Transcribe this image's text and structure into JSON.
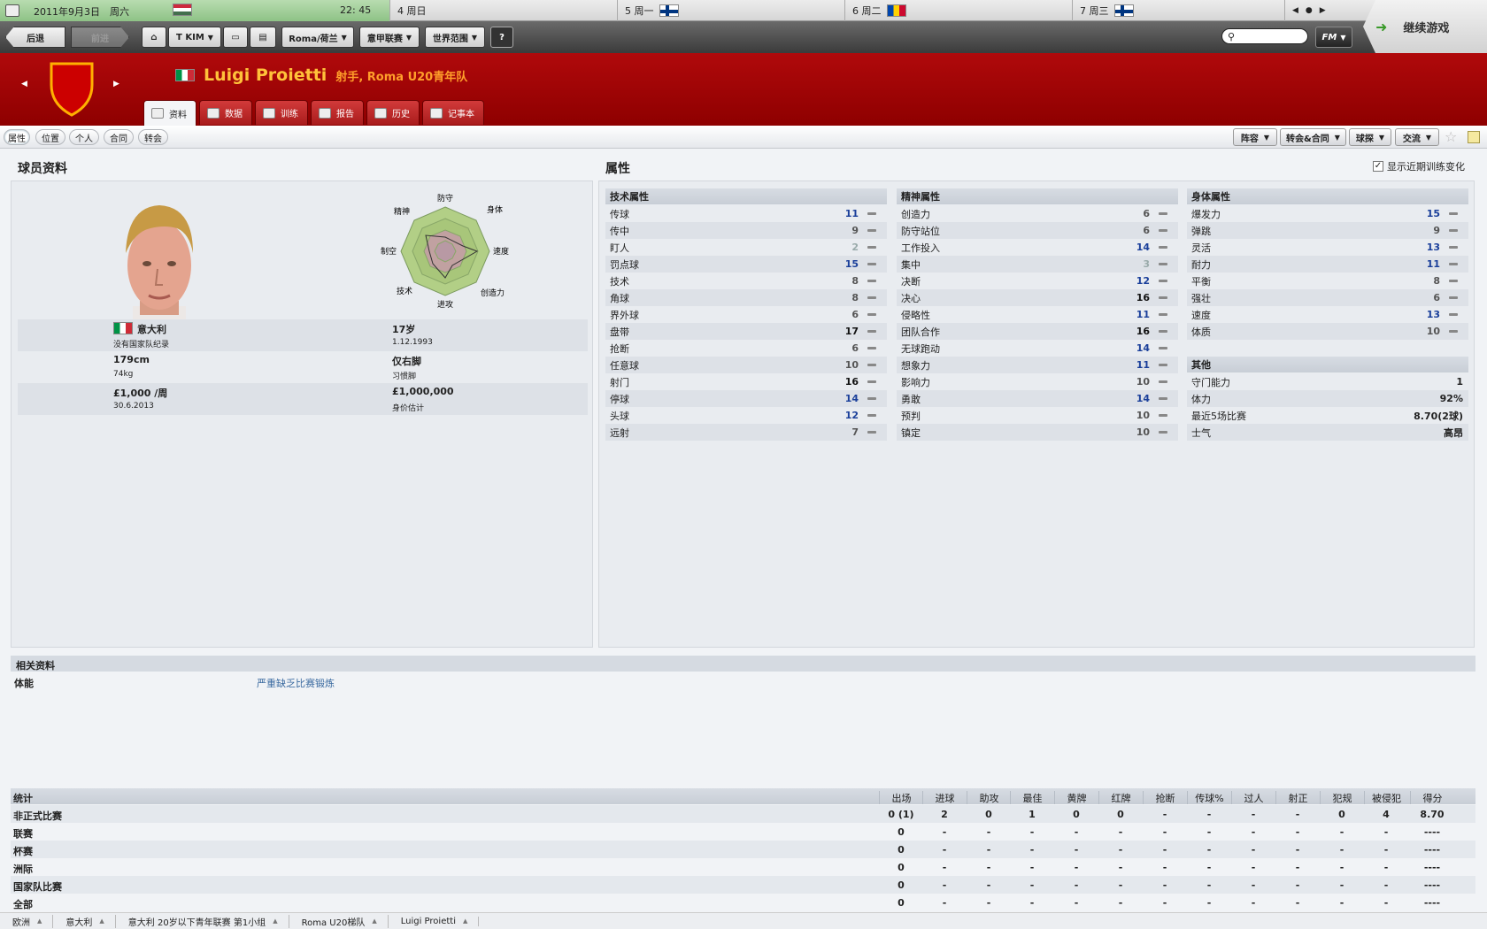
{
  "calendar": {
    "date": "2011年9月3日",
    "weekday": "周六",
    "time": "22: 45",
    "days": [
      {
        "label": "4 周日",
        "flag": ""
      },
      {
        "label": "5 周一",
        "flag": "fi"
      },
      {
        "label": "6 周二",
        "flag": "md"
      },
      {
        "label": "7 周三",
        "flag": "fi"
      }
    ]
  },
  "nav": {
    "back": "后退",
    "forward": "前进",
    "manager": "T KIM",
    "club_menu": "Roma/荷兰",
    "league_menu": "意甲联赛",
    "world_menu": "世界范围",
    "help": "?",
    "search_placeholder": "",
    "fm_menu": "FM",
    "continue": "继续游戏"
  },
  "player": {
    "name": "Luigi Proietti",
    "subtitle": "射手, Roma U20青年队"
  },
  "tabs": [
    {
      "label": "资料",
      "active": true
    },
    {
      "label": "数据"
    },
    {
      "label": "训练"
    },
    {
      "label": "报告"
    },
    {
      "label": "历史"
    },
    {
      "label": "记事本"
    }
  ],
  "subtabs": [
    "属性",
    "位置",
    "个人",
    "合同",
    "转会"
  ],
  "right_buttons": [
    "阵容",
    "转会&合同",
    "球探",
    "交流"
  ],
  "profile": {
    "title": "球员资料",
    "nationality": "意大利",
    "intl": "没有国家队纪录",
    "age": "17岁",
    "dob": "1.12.1993",
    "height": "179cm",
    "weight": "74kg",
    "foot": "仅右脚",
    "foot_label": "习惯脚",
    "wage": "£1,000 /周",
    "contract_end": "30.6.2013",
    "value": "£1,000,000",
    "value_label": "身价估计"
  },
  "radar": {
    "labels": [
      "防守",
      "身体",
      "速度",
      "创造力",
      "进攻",
      "技术",
      "制空",
      "精神"
    ]
  },
  "attributes": {
    "title": "属性",
    "show_changes": "显示近期训练变化",
    "technical": {
      "title": "技术属性",
      "rows": [
        {
          "name": "传球",
          "value": "11",
          "style": "blue"
        },
        {
          "name": "传中",
          "value": "9",
          "style": "grey2"
        },
        {
          "name": "盯人",
          "value": "2",
          "style": "grey"
        },
        {
          "name": "罚点球",
          "value": "15",
          "style": "blue"
        },
        {
          "name": "技术",
          "value": "8",
          "style": "grey2"
        },
        {
          "name": "角球",
          "value": "8",
          "style": "grey2"
        },
        {
          "name": "界外球",
          "value": "6",
          "style": "grey2"
        },
        {
          "name": "盘带",
          "value": "17",
          "style": "black"
        },
        {
          "name": "抢断",
          "value": "6",
          "style": "grey2"
        },
        {
          "name": "任意球",
          "value": "10",
          "style": "grey2"
        },
        {
          "name": "射门",
          "value": "16",
          "style": "black"
        },
        {
          "name": "停球",
          "value": "14",
          "style": "blue"
        },
        {
          "name": "头球",
          "value": "12",
          "style": "blue"
        },
        {
          "name": "远射",
          "value": "7",
          "style": "grey2"
        }
      ]
    },
    "mental": {
      "title": "精神属性",
      "rows": [
        {
          "name": "创造力",
          "value": "6",
          "style": "grey2"
        },
        {
          "name": "防守站位",
          "value": "6",
          "style": "grey2"
        },
        {
          "name": "工作投入",
          "value": "14",
          "style": "blue"
        },
        {
          "name": "集中",
          "value": "3",
          "style": "grey"
        },
        {
          "name": "决断",
          "value": "12",
          "style": "blue"
        },
        {
          "name": "决心",
          "value": "16",
          "style": "black"
        },
        {
          "name": "侵略性",
          "value": "11",
          "style": "blue"
        },
        {
          "name": "团队合作",
          "value": "16",
          "style": "black"
        },
        {
          "name": "无球跑动",
          "value": "14",
          "style": "blue"
        },
        {
          "name": "想象力",
          "value": "11",
          "style": "blue"
        },
        {
          "name": "影响力",
          "value": "10",
          "style": "grey2"
        },
        {
          "name": "勇敢",
          "value": "14",
          "style": "blue"
        },
        {
          "name": "预判",
          "value": "10",
          "style": "grey2"
        },
        {
          "name": "镇定",
          "value": "10",
          "style": "grey2"
        }
      ]
    },
    "physical": {
      "title": "身体属性",
      "rows": [
        {
          "name": "爆发力",
          "value": "15",
          "style": "blue"
        },
        {
          "name": "弹跳",
          "value": "9",
          "style": "grey2"
        },
        {
          "name": "灵活",
          "value": "13",
          "style": "blue"
        },
        {
          "name": "耐力",
          "value": "11",
          "style": "blue"
        },
        {
          "name": "平衡",
          "value": "8",
          "style": "grey2"
        },
        {
          "name": "强壮",
          "value": "6",
          "style": "grey2"
        },
        {
          "name": "速度",
          "value": "13",
          "style": "blue"
        },
        {
          "name": "体质",
          "value": "10",
          "style": "grey2"
        }
      ]
    },
    "other": {
      "title": "其他",
      "rows": [
        {
          "name": "守门能力",
          "value": "1"
        },
        {
          "name": "体力",
          "value": "92%"
        },
        {
          "name": "最近5场比赛",
          "value": "8.70(2球)"
        },
        {
          "name": "士气",
          "value": "高昂"
        }
      ]
    }
  },
  "related": {
    "title": "相关资料",
    "label": "体能",
    "value": "严重缺乏比赛锻炼"
  },
  "stats": {
    "title": "统计",
    "headers": [
      "出场",
      "进球",
      "助攻",
      "最佳",
      "黄牌",
      "红牌",
      "抢断",
      "传球%",
      "过人",
      "射正",
      "犯规",
      "被侵犯",
      "得分"
    ],
    "rows": [
      {
        "name": "非正式比赛",
        "cells": [
          "0 (1)",
          "2",
          "0",
          "1",
          "0",
          "0",
          "-",
          "-",
          "-",
          "-",
          "0",
          "4",
          "8.70"
        ]
      },
      {
        "name": "联赛",
        "cells": [
          "0",
          "-",
          "-",
          "-",
          "-",
          "-",
          "-",
          "-",
          "-",
          "-",
          "-",
          "-",
          "----"
        ]
      },
      {
        "name": "杯赛",
        "cells": [
          "0",
          "-",
          "-",
          "-",
          "-",
          "-",
          "-",
          "-",
          "-",
          "-",
          "-",
          "-",
          "----"
        ]
      },
      {
        "name": "洲际",
        "cells": [
          "0",
          "-",
          "-",
          "-",
          "-",
          "-",
          "-",
          "-",
          "-",
          "-",
          "-",
          "-",
          "----"
        ]
      },
      {
        "name": "国家队比赛",
        "cells": [
          "0",
          "-",
          "-",
          "-",
          "-",
          "-",
          "-",
          "-",
          "-",
          "-",
          "-",
          "-",
          "----"
        ]
      },
      {
        "name": "全部",
        "cells": [
          "0",
          "-",
          "-",
          "-",
          "-",
          "-",
          "-",
          "-",
          "-",
          "-",
          "-",
          "-",
          "----"
        ]
      }
    ]
  },
  "breadcrumbs": [
    "欧洲",
    "意大利",
    "意大利 20岁以下青年联赛 第1小组",
    "Roma U20梯队",
    "Luigi Proietti"
  ]
}
